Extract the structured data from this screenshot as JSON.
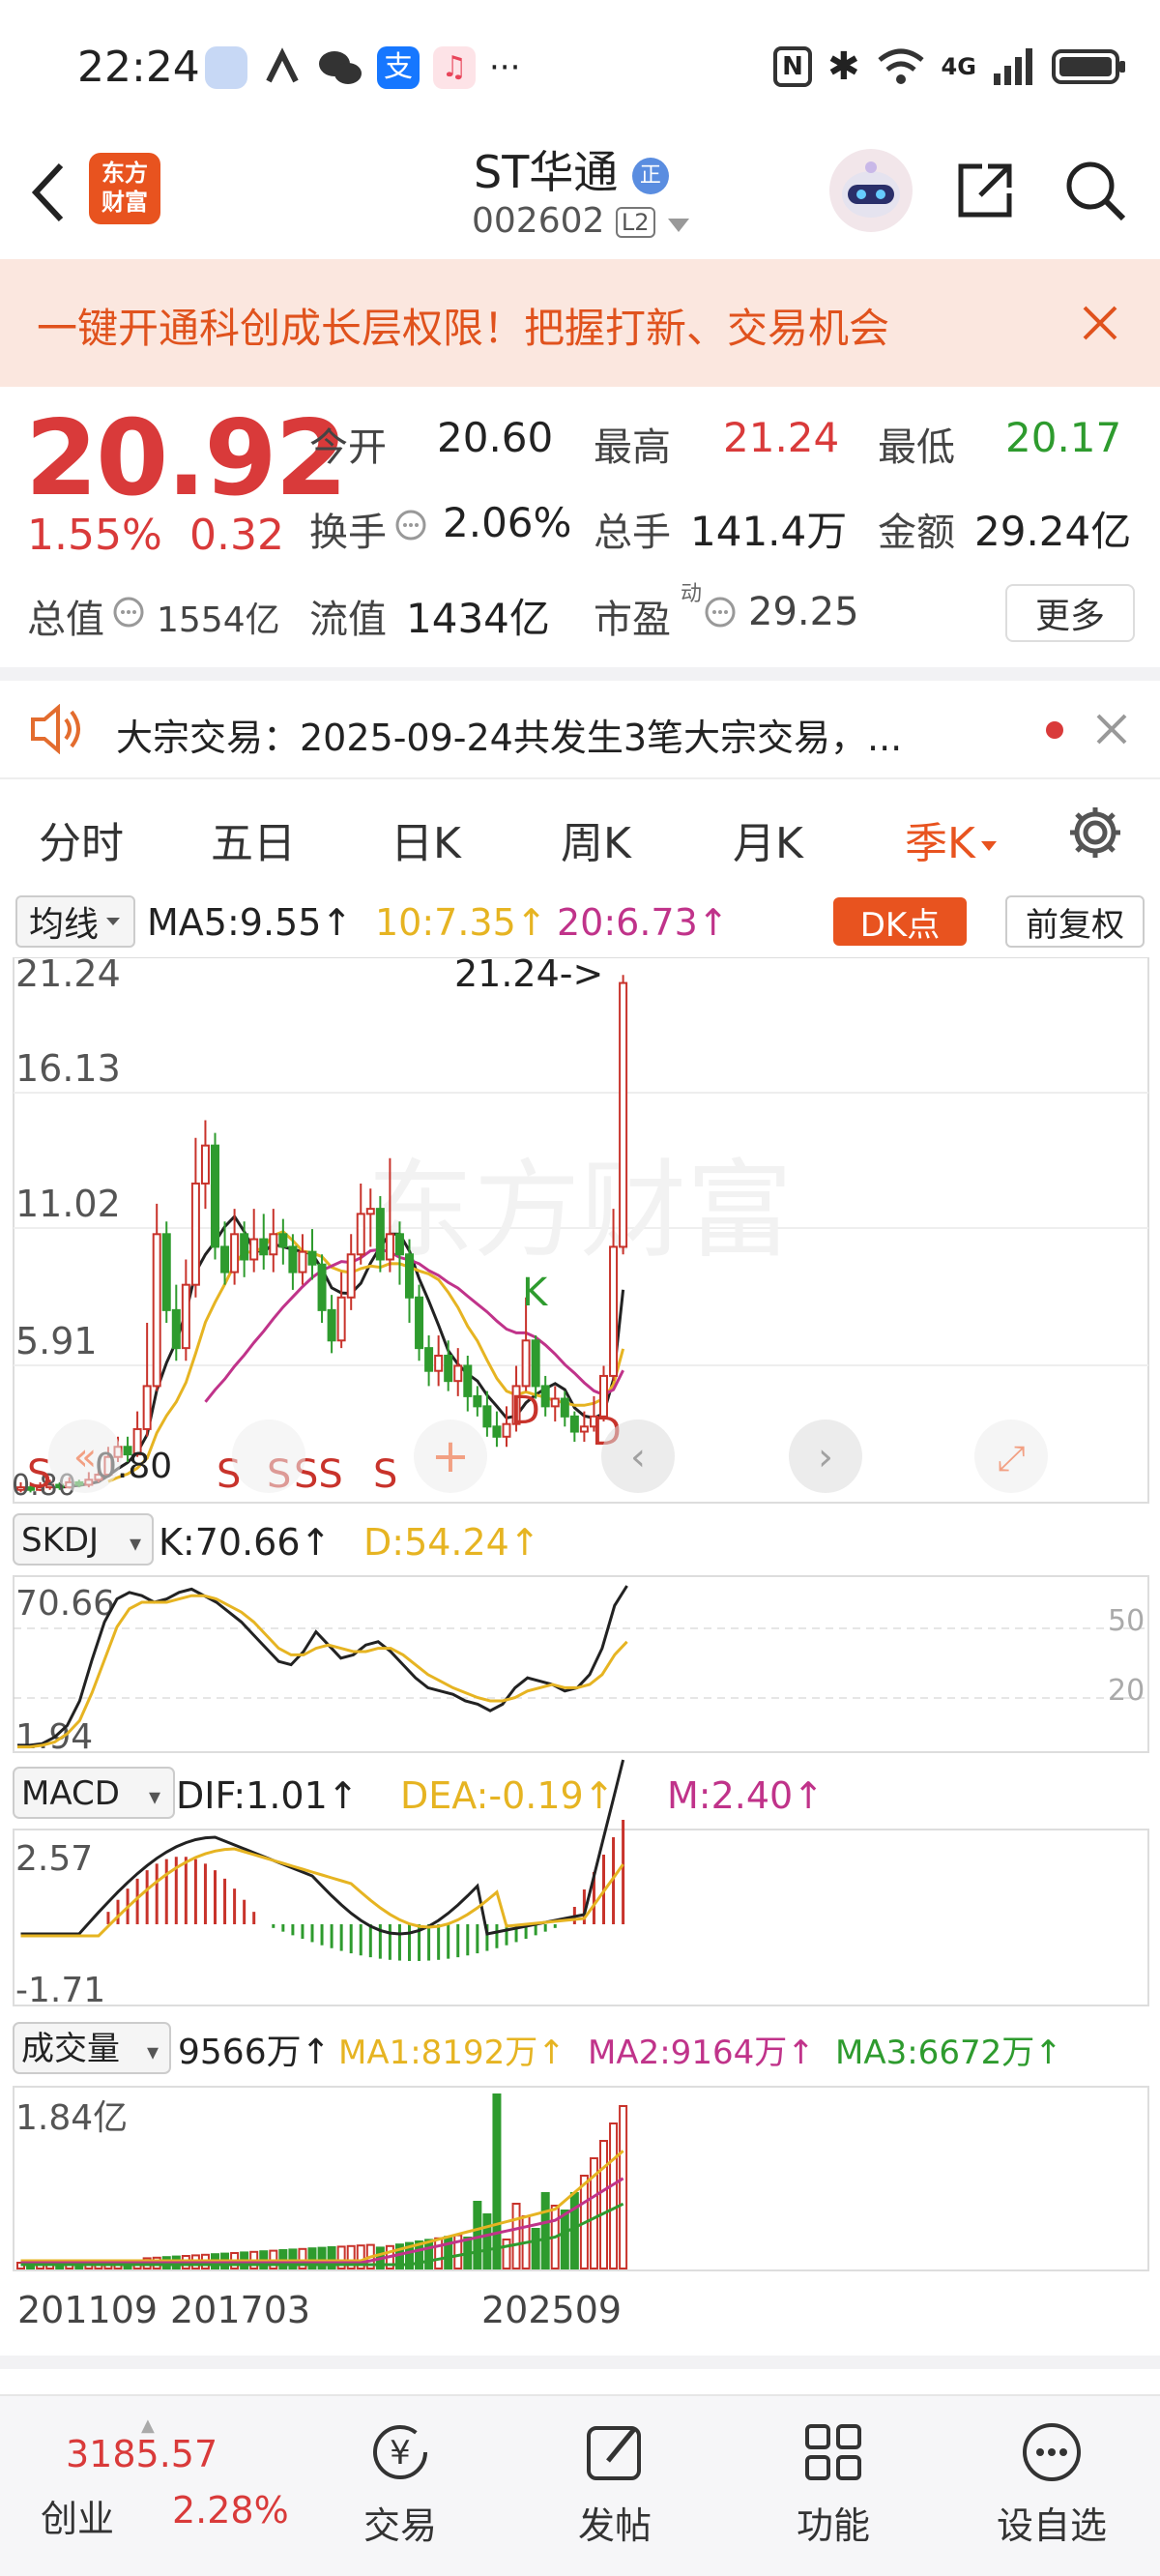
{
  "status_bar": {
    "time": "22:24",
    "dots": "···",
    "network": "4G"
  },
  "header": {
    "logo_text_1": "东方",
    "logo_text_2": "财富",
    "stock_name": "ST华通",
    "badge": "正",
    "stock_code": "002602",
    "level_badge": "L2"
  },
  "banner": {
    "text": "一键开通科创成长层权限！把握打新、交易机会"
  },
  "quote": {
    "price": "20.92",
    "change_pct": "1.55%",
    "change_abs": "0.32",
    "open_label": "今开",
    "open": "20.60",
    "high_label": "最高",
    "high": "21.24",
    "low_label": "最低",
    "low": "20.17",
    "turnover_label": "换手",
    "turnover": "2.06%",
    "volume_label": "总手",
    "volume": "141.4万",
    "amount_label": "金额",
    "amount": "29.24亿",
    "mktcap_label": "总值",
    "mktcap": "1554亿",
    "float_label": "流值",
    "float": "1434亿",
    "pe_label": "市盈",
    "pe_sup": "动",
    "pe": "29.25",
    "more_label": "更多"
  },
  "notice": {
    "text": "大宗交易：2025-09-24共发生3笔大宗交易，..."
  },
  "tabs": {
    "items": [
      "分时",
      "五日",
      "日K",
      "周K",
      "月K",
      "季K"
    ],
    "active_index": 5
  },
  "indicators": {
    "ma_selector": "均线",
    "ma5": "MA5:9.55↑",
    "ma10": "10:7.35↑",
    "ma20": "20:6.73↑",
    "dk_button": "DK点",
    "fq_button": "前复权",
    "skdj_selector": "SKDJ",
    "skdj_k": "K:70.66↑",
    "skdj_d": "D:54.24↑",
    "macd_selector": "MACD",
    "macd_dif": "DIF:1.01↑",
    "macd_dea": "DEA:-0.19↑",
    "macd_m": "M:2.40↑",
    "vol_selector": "成交量",
    "vol_val": "9566万↑",
    "vol_ma1": "MA1:8192万↑",
    "vol_ma2": "MA2:9164万↑",
    "vol_ma3": "MA3:6672万↑"
  },
  "chart_data": {
    "type": "candlestick",
    "price_axis_labels": [
      "21.24",
      "16.13",
      "11.02",
      "5.91",
      "0.80"
    ],
    "max_label": "21.24->",
    "min_label": "0.80",
    "skdj_axis_labels": [
      "70.66",
      "1.94"
    ],
    "skdj_right_labels": [
      "50",
      "20"
    ],
    "macd_axis_labels": [
      "2.57",
      "-1.71"
    ],
    "vol_axis_label": "1.84亿",
    "x_labels": [
      "201109",
      "201703",
      "202509"
    ],
    "markers": [
      "S",
      "S",
      "S",
      "SS",
      "S",
      "K",
      "D",
      "D"
    ],
    "candles": [
      {
        "o": 0.9,
        "c": 1.0,
        "h": 1.2,
        "l": 0.8
      },
      {
        "o": 1.0,
        "c": 0.9,
        "h": 1.1,
        "l": 0.8
      },
      {
        "o": 0.9,
        "c": 1.0,
        "h": 1.2,
        "l": 0.85
      },
      {
        "o": 1.0,
        "c": 1.1,
        "h": 1.3,
        "l": 0.9
      },
      {
        "o": 1.1,
        "c": 1.0,
        "h": 1.2,
        "l": 0.9
      },
      {
        "o": 1.0,
        "c": 1.2,
        "h": 1.4,
        "l": 0.95
      },
      {
        "o": 1.2,
        "c": 1.1,
        "h": 1.3,
        "l": 1.0
      },
      {
        "o": 1.1,
        "c": 1.3,
        "h": 1.6,
        "l": 1.0
      },
      {
        "o": 1.3,
        "c": 1.5,
        "h": 1.8,
        "l": 1.2
      },
      {
        "o": 1.5,
        "c": 2.2,
        "h": 2.6,
        "l": 1.4
      },
      {
        "o": 2.2,
        "c": 2.6,
        "h": 3.0,
        "l": 2.0
      },
      {
        "o": 2.6,
        "c": 2.3,
        "h": 3.0,
        "l": 2.0
      },
      {
        "o": 2.3,
        "c": 3.3,
        "h": 4.0,
        "l": 2.2
      },
      {
        "o": 3.3,
        "c": 5.0,
        "h": 7.5,
        "l": 3.0
      },
      {
        "o": 5.0,
        "c": 11.0,
        "h": 12.2,
        "l": 4.8
      },
      {
        "o": 11.0,
        "c": 8.0,
        "h": 11.5,
        "l": 7.5
      },
      {
        "o": 8.0,
        "c": 6.5,
        "h": 9.0,
        "l": 6.0
      },
      {
        "o": 6.5,
        "c": 9.0,
        "h": 10.0,
        "l": 6.0
      },
      {
        "o": 9.0,
        "c": 13.0,
        "h": 14.8,
        "l": 8.5
      },
      {
        "o": 13.0,
        "c": 14.5,
        "h": 15.5,
        "l": 12.0
      },
      {
        "o": 14.5,
        "c": 10.5,
        "h": 15.0,
        "l": 10.0
      },
      {
        "o": 10.5,
        "c": 9.5,
        "h": 11.5,
        "l": 9.0
      },
      {
        "o": 9.5,
        "c": 11.0,
        "h": 12.0,
        "l": 9.0
      },
      {
        "o": 11.0,
        "c": 10.0,
        "h": 11.5,
        "l": 9.3
      },
      {
        "o": 10.0,
        "c": 10.8,
        "h": 12.0,
        "l": 9.5
      },
      {
        "o": 10.8,
        "c": 10.2,
        "h": 11.8,
        "l": 9.6
      },
      {
        "o": 10.2,
        "c": 11.0,
        "h": 12.0,
        "l": 9.5
      },
      {
        "o": 11.0,
        "c": 10.5,
        "h": 11.6,
        "l": 9.8
      },
      {
        "o": 10.5,
        "c": 9.5,
        "h": 11.0,
        "l": 8.8
      },
      {
        "o": 9.5,
        "c": 10.3,
        "h": 11.0,
        "l": 9.0
      },
      {
        "o": 10.3,
        "c": 9.8,
        "h": 11.2,
        "l": 9.2
      },
      {
        "o": 9.8,
        "c": 8.0,
        "h": 10.2,
        "l": 7.5
      },
      {
        "o": 8.0,
        "c": 6.8,
        "h": 8.6,
        "l": 6.3
      },
      {
        "o": 6.8,
        "c": 8.5,
        "h": 9.5,
        "l": 6.5
      },
      {
        "o": 8.5,
        "c": 10.2,
        "h": 11.0,
        "l": 8.0
      },
      {
        "o": 10.2,
        "c": 11.8,
        "h": 13.0,
        "l": 9.8
      },
      {
        "o": 11.8,
        "c": 12.0,
        "h": 12.8,
        "l": 10.5
      },
      {
        "o": 12.0,
        "c": 10.0,
        "h": 12.5,
        "l": 9.5
      },
      {
        "o": 10.0,
        "c": 11.0,
        "h": 14.0,
        "l": 9.5
      },
      {
        "o": 11.0,
        "c": 10.2,
        "h": 11.5,
        "l": 9.0
      },
      {
        "o": 10.2,
        "c": 8.5,
        "h": 10.8,
        "l": 7.5
      },
      {
        "o": 8.5,
        "c": 6.5,
        "h": 9.0,
        "l": 6.0
      },
      {
        "o": 6.5,
        "c": 5.6,
        "h": 7.0,
        "l": 5.0
      },
      {
        "o": 5.6,
        "c": 6.2,
        "h": 7.0,
        "l": 5.0
      },
      {
        "o": 6.2,
        "c": 5.2,
        "h": 6.8,
        "l": 4.8
      },
      {
        "o": 5.2,
        "c": 5.8,
        "h": 6.5,
        "l": 4.6
      },
      {
        "o": 5.8,
        "c": 4.6,
        "h": 6.2,
        "l": 4.0
      },
      {
        "o": 4.6,
        "c": 4.2,
        "h": 5.0,
        "l": 3.8
      },
      {
        "o": 4.2,
        "c": 3.4,
        "h": 4.8,
        "l": 3.0
      },
      {
        "o": 3.4,
        "c": 3.0,
        "h": 4.0,
        "l": 2.6
      },
      {
        "o": 3.0,
        "c": 3.5,
        "h": 4.2,
        "l": 2.6
      },
      {
        "o": 3.5,
        "c": 5.0,
        "h": 5.8,
        "l": 3.2
      },
      {
        "o": 5.0,
        "c": 6.8,
        "h": 8.5,
        "l": 4.8
      },
      {
        "o": 6.8,
        "c": 5.0,
        "h": 7.0,
        "l": 4.5
      },
      {
        "o": 5.0,
        "c": 4.2,
        "h": 5.4,
        "l": 3.8
      },
      {
        "o": 4.2,
        "c": 4.5,
        "h": 5.0,
        "l": 3.6
      },
      {
        "o": 4.5,
        "c": 3.8,
        "h": 4.8,
        "l": 3.4
      },
      {
        "o": 3.8,
        "c": 3.2,
        "h": 4.0,
        "l": 2.8
      },
      {
        "o": 3.2,
        "c": 3.4,
        "h": 4.0,
        "l": 2.8
      },
      {
        "o": 3.4,
        "c": 3.8,
        "h": 4.6,
        "l": 3.2
      },
      {
        "o": 3.8,
        "c": 5.4,
        "h": 5.8,
        "l": 3.6
      },
      {
        "o": 5.4,
        "c": 10.5,
        "h": 12.0,
        "l": 5.2
      },
      {
        "o": 10.5,
        "c": 20.92,
        "h": 21.24,
        "l": 10.2
      }
    ]
  },
  "bottom_bar": {
    "index_value": "3185.57",
    "index_name": "创业",
    "index_change": "2.28%",
    "nav": [
      "交易",
      "发帖",
      "功能",
      "设自选"
    ]
  }
}
